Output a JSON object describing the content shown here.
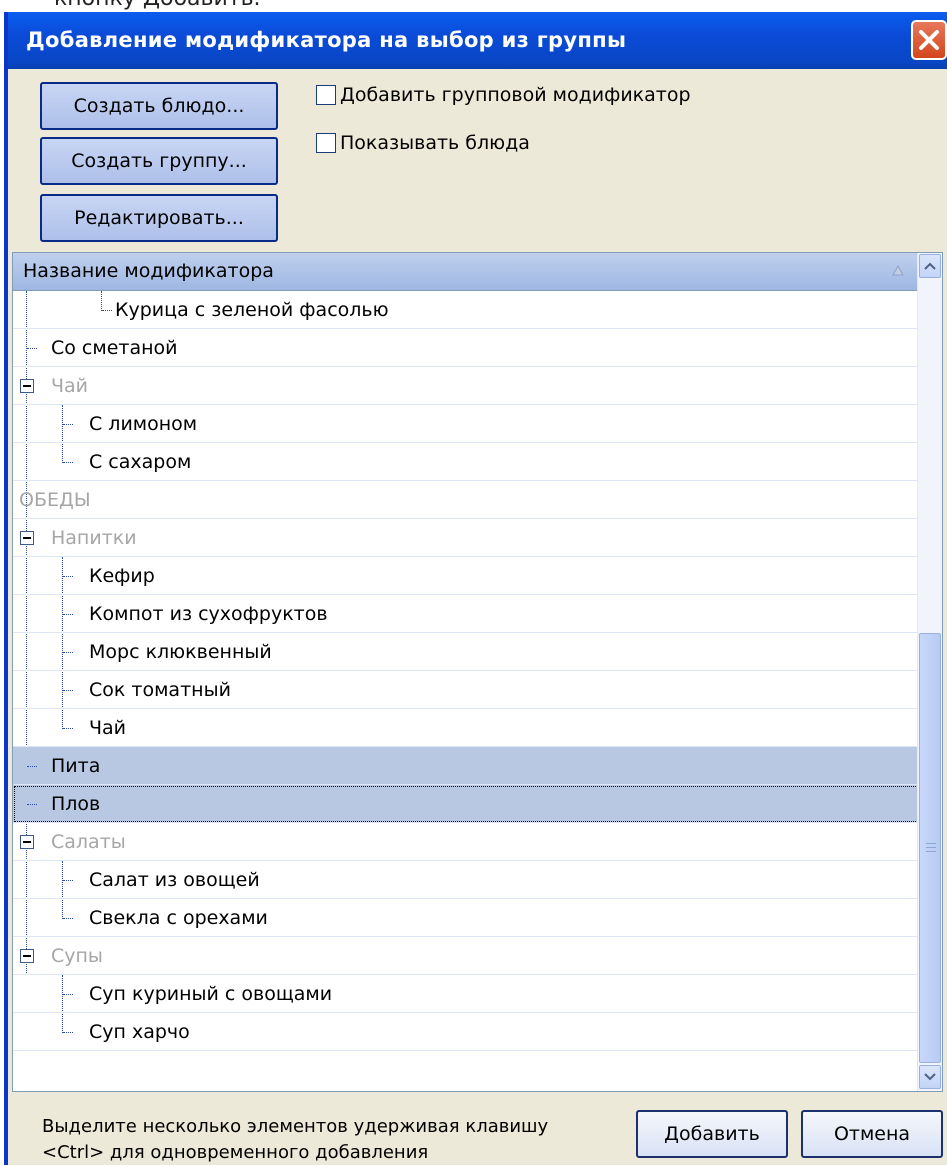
{
  "caption": "кнопку Добавить.",
  "window": {
    "title": "Добавление модификатора на выбор из группы"
  },
  "toolbar": {
    "create_dish": "Создать блюдо...",
    "create_group": "Создать группу...",
    "edit": "Редактировать...",
    "add_group_modifier": "Добавить групповой модификатор",
    "show_dishes": "Показывать блюда"
  },
  "tree": {
    "header": "Название модификатора",
    "rows": [
      {
        "label": "Курица с зеленой фасолью",
        "kind": "item"
      },
      {
        "label": "Со сметаной",
        "kind": "item"
      },
      {
        "label": "Чай",
        "kind": "group"
      },
      {
        "label": "С лимоном",
        "kind": "item"
      },
      {
        "label": "С сахаром",
        "kind": "item"
      },
      {
        "label": "ОБЕДЫ",
        "kind": "group"
      },
      {
        "label": "Напитки",
        "kind": "group"
      },
      {
        "label": "Кефир",
        "kind": "item"
      },
      {
        "label": "Компот из сухофруктов",
        "kind": "item"
      },
      {
        "label": "Морс клюквенный",
        "kind": "item"
      },
      {
        "label": "Сок томатный",
        "kind": "item"
      },
      {
        "label": "Чай",
        "kind": "item"
      },
      {
        "label": "Пита",
        "kind": "item",
        "selected": true
      },
      {
        "label": "Плов",
        "kind": "item",
        "selected": true,
        "focused": true
      },
      {
        "label": "Салаты",
        "kind": "group"
      },
      {
        "label": "Салат из овощей",
        "kind": "item"
      },
      {
        "label": "Свекла с орехами",
        "kind": "item"
      },
      {
        "label": "Супы",
        "kind": "group"
      },
      {
        "label": "Суп куриный с овощами",
        "kind": "item"
      },
      {
        "label": "Суп харчо",
        "kind": "item"
      }
    ]
  },
  "footer": {
    "hint_line1": "Выделите несколько элементов удерживая клавишу",
    "hint_line2": "<Ctrl> для одновременного добавления",
    "add_button": "Добавить",
    "cancel_button": "Отмена"
  },
  "colors": {
    "titlebar": "#0b4bd8",
    "selection": "#b9c8e2",
    "group_text": "#a6a6a6"
  },
  "icons": [
    "close-icon",
    "sort-asc-icon",
    "collapse-icon",
    "scroll-up-icon",
    "scroll-down-icon"
  ]
}
